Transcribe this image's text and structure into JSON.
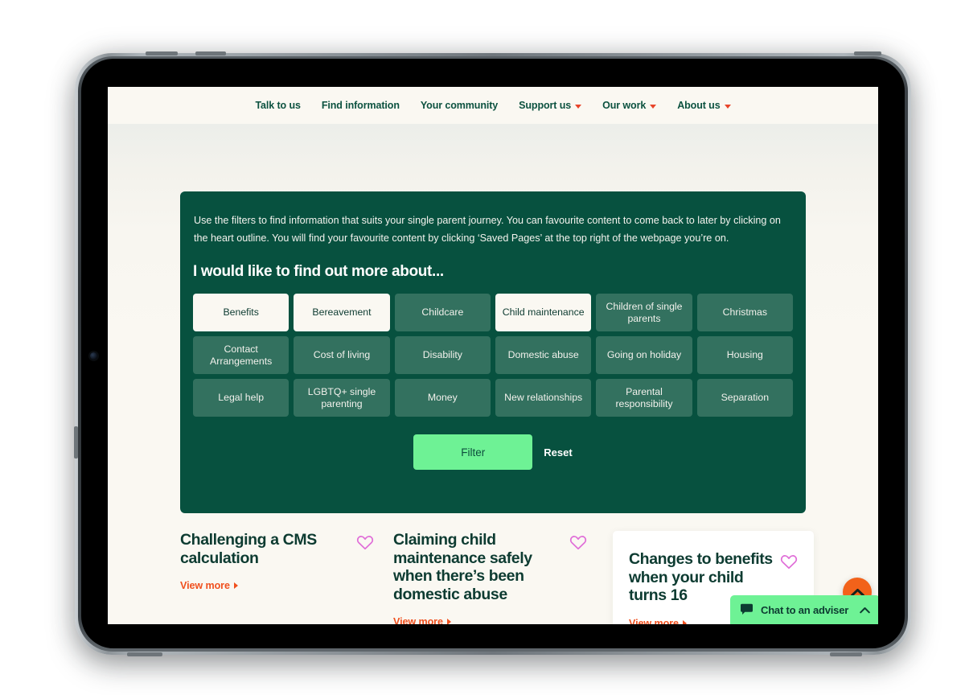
{
  "nav": {
    "items": [
      {
        "label": "Talk to us",
        "has_dropdown": false
      },
      {
        "label": "Find information",
        "has_dropdown": false
      },
      {
        "label": "Your community",
        "has_dropdown": false
      },
      {
        "label": "Support us",
        "has_dropdown": true
      },
      {
        "label": "Our work",
        "has_dropdown": true
      },
      {
        "label": "About us",
        "has_dropdown": true
      }
    ]
  },
  "filter_panel": {
    "intro": "Use the filters to find information that suits your single parent journey. You can favourite content to come back to later by clicking on the heart outline. You will find your favourite content by clicking ‘Saved Pages’ at the top right of the webpage you’re on.",
    "heading": "I would like to find out more about...",
    "chips": [
      {
        "label": "Benefits",
        "selected": true
      },
      {
        "label": "Bereavement",
        "selected": true
      },
      {
        "label": "Childcare",
        "selected": false
      },
      {
        "label": "Child maintenance",
        "selected": true
      },
      {
        "label": "Children of single parents",
        "selected": false
      },
      {
        "label": "Christmas",
        "selected": false
      },
      {
        "label": "Contact Arrangements",
        "selected": false
      },
      {
        "label": "Cost of living",
        "selected": false
      },
      {
        "label": "Disability",
        "selected": false
      },
      {
        "label": "Domestic abuse",
        "selected": false
      },
      {
        "label": "Going on holiday",
        "selected": false
      },
      {
        "label": "Housing",
        "selected": false
      },
      {
        "label": "Legal help",
        "selected": false
      },
      {
        "label": "LGBTQ+ single parenting",
        "selected": false
      },
      {
        "label": "Money",
        "selected": false
      },
      {
        "label": "New relationships",
        "selected": false
      },
      {
        "label": "Parental responsibility",
        "selected": false
      },
      {
        "label": "Separation",
        "selected": false
      }
    ],
    "filter_label": "Filter",
    "reset_label": "Reset"
  },
  "results": {
    "view_more_label": "View more",
    "cards": [
      {
        "title": "Challenging a CMS calculation",
        "elevated": false
      },
      {
        "title": "Claiming child maintenance safely when there’s been domestic abuse",
        "elevated": false
      },
      {
        "title": "Changes to benefits when your child turns 16",
        "elevated": true
      }
    ]
  },
  "widgets": {
    "chat_label": "Chat to an adviser",
    "scroll_top_icon": "chevron-up-icon",
    "chat_icon": "speech-bubble-icon"
  },
  "colors": {
    "panel_green": "#07513f",
    "chip_green": "#33715f",
    "chip_selected_bg": "#faf8f2",
    "accent_green": "#6ef295",
    "heading_green": "#0d3b31",
    "nav_green": "#0c5240",
    "orange": "#f0501e",
    "scroll_top_orange": "#f2621a",
    "heart_pink": "#e06fd8",
    "page_cream": "#faf8f2",
    "dropdown_red": "#e8452b"
  }
}
